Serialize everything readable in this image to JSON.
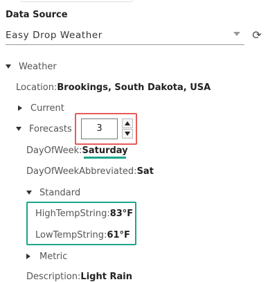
{
  "data_source": {
    "title": "Data Source",
    "selected": "Easy Drop Weather"
  },
  "tree": {
    "weather_label": "Weather",
    "location_key": "Location:",
    "location_value": "Brookings, South Dakota, USA",
    "current_label": "Current",
    "forecasts_label": "Forecasts",
    "forecast_index": "3",
    "dayofweek_key": "DayOfWeek:",
    "dayofweek_value": "Saturday",
    "dayofweek_abbrev_key": "DayOfWeekAbbreviated:",
    "dayofweek_abbrev_value": "Sat",
    "standard_label": "Standard",
    "hightemp_key": "HighTempString:",
    "hightemp_value": "83°F",
    "lowtemp_key": "LowTempString:",
    "lowtemp_value": "61°F",
    "metric_label": "Metric",
    "description_key": "Description:",
    "description_value": "Light Rain"
  },
  "colors": {
    "highlight_red": "#e85a5a",
    "highlight_green": "#1aa68a"
  },
  "icons": {
    "refresh": "refresh-icon",
    "dropdown": "chevron-down-icon"
  }
}
